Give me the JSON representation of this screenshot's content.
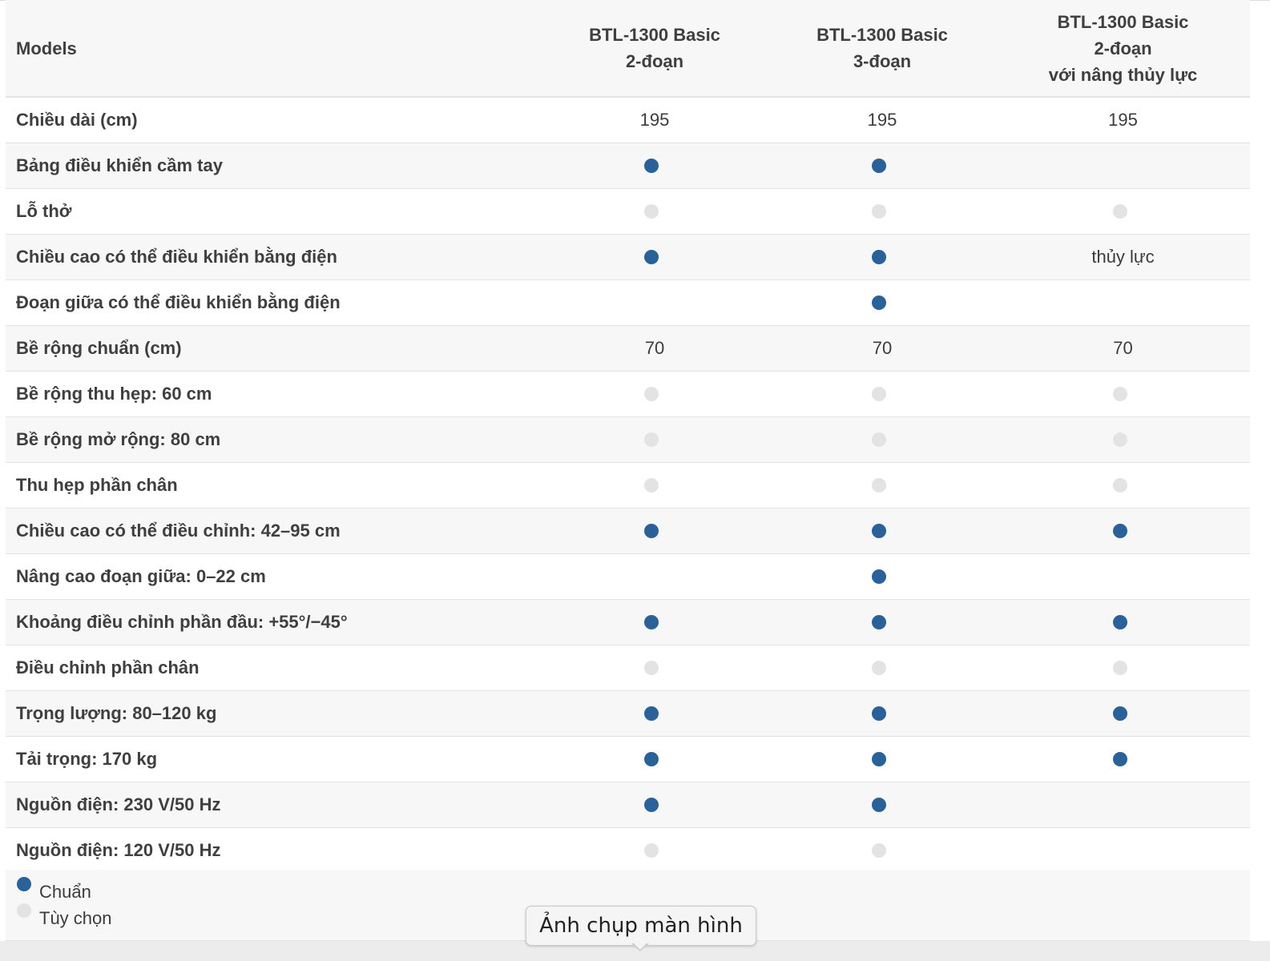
{
  "table": {
    "header": {
      "label": "Models",
      "models": [
        {
          "lines": [
            "BTL-1300 Basic",
            "2-đoạn"
          ]
        },
        {
          "lines": [
            "BTL-1300 Basic",
            "3-đoạn"
          ]
        },
        {
          "lines": [
            "BTL-1300 Basic",
            "2-đoạn",
            "với nâng thủy lực"
          ]
        }
      ]
    },
    "rows": [
      {
        "label": "Chiều dài (cm)",
        "cells": [
          {
            "type": "text",
            "value": "195"
          },
          {
            "type": "text",
            "value": "195"
          },
          {
            "type": "text",
            "value": "195"
          }
        ]
      },
      {
        "label": "Bảng điều khiển cầm tay",
        "cells": [
          {
            "type": "standard"
          },
          {
            "type": "standard"
          },
          {
            "type": "none"
          }
        ]
      },
      {
        "label": "Lỗ thở",
        "cells": [
          {
            "type": "optional"
          },
          {
            "type": "optional"
          },
          {
            "type": "optional"
          }
        ]
      },
      {
        "label": "Chiều cao có thể điều khiển bằng điện",
        "cells": [
          {
            "type": "standard"
          },
          {
            "type": "standard"
          },
          {
            "type": "text",
            "value": "thủy lực"
          }
        ]
      },
      {
        "label": "Đoạn giữa có thể điều khiển bằng điện",
        "cells": [
          {
            "type": "none"
          },
          {
            "type": "standard"
          },
          {
            "type": "none"
          }
        ]
      },
      {
        "label": "Bề rộng chuẩn (cm)",
        "cells": [
          {
            "type": "text",
            "value": "70"
          },
          {
            "type": "text",
            "value": "70"
          },
          {
            "type": "text",
            "value": "70"
          }
        ]
      },
      {
        "label": "Bề rộng thu hẹp: 60 cm",
        "cells": [
          {
            "type": "optional"
          },
          {
            "type": "optional"
          },
          {
            "type": "optional"
          }
        ]
      },
      {
        "label": "Bề rộng mở rộng: 80 cm",
        "cells": [
          {
            "type": "optional"
          },
          {
            "type": "optional"
          },
          {
            "type": "optional"
          }
        ]
      },
      {
        "label": "Thu hẹp phần chân",
        "cells": [
          {
            "type": "optional"
          },
          {
            "type": "optional"
          },
          {
            "type": "optional"
          }
        ]
      },
      {
        "label": "Chiều cao có thể điều chỉnh: 42–95 cm",
        "cells": [
          {
            "type": "standard"
          },
          {
            "type": "standard"
          },
          {
            "type": "standard"
          }
        ]
      },
      {
        "label": "Nâng cao đoạn giữa: 0–22 cm",
        "cells": [
          {
            "type": "none"
          },
          {
            "type": "standard"
          },
          {
            "type": "none"
          }
        ]
      },
      {
        "label": "Khoảng điều chỉnh phần đầu: +55°/−45°",
        "cells": [
          {
            "type": "standard"
          },
          {
            "type": "standard"
          },
          {
            "type": "standard"
          }
        ]
      },
      {
        "label": "Điều chỉnh phần chân",
        "cells": [
          {
            "type": "optional"
          },
          {
            "type": "optional"
          },
          {
            "type": "optional"
          }
        ]
      },
      {
        "label": "Trọng lượng: 80–120 kg",
        "cells": [
          {
            "type": "standard"
          },
          {
            "type": "standard"
          },
          {
            "type": "standard"
          }
        ]
      },
      {
        "label": "Tải trọng: 170 kg",
        "cells": [
          {
            "type": "standard"
          },
          {
            "type": "standard"
          },
          {
            "type": "standard"
          }
        ]
      },
      {
        "label": "Nguồn điện: 230 V/50 Hz",
        "cells": [
          {
            "type": "standard"
          },
          {
            "type": "standard"
          },
          {
            "type": "none"
          }
        ]
      },
      {
        "label": "Nguồn điện: 120 V/50 Hz",
        "cells": [
          {
            "type": "optional"
          },
          {
            "type": "optional"
          },
          {
            "type": "none"
          }
        ]
      }
    ]
  },
  "legend": {
    "standard_label": "Chuẩn",
    "optional_label": "Tùy chọn"
  },
  "tooltip": {
    "text": "Ảnh chụp màn hình"
  },
  "colors": {
    "standard_dot": "#2a6199",
    "optional_dot": "#e3e3e3",
    "row_alt": "#f7f7f7"
  },
  "icons": {
    "standard": "filled-circle-icon",
    "optional": "filled-circle-icon"
  }
}
